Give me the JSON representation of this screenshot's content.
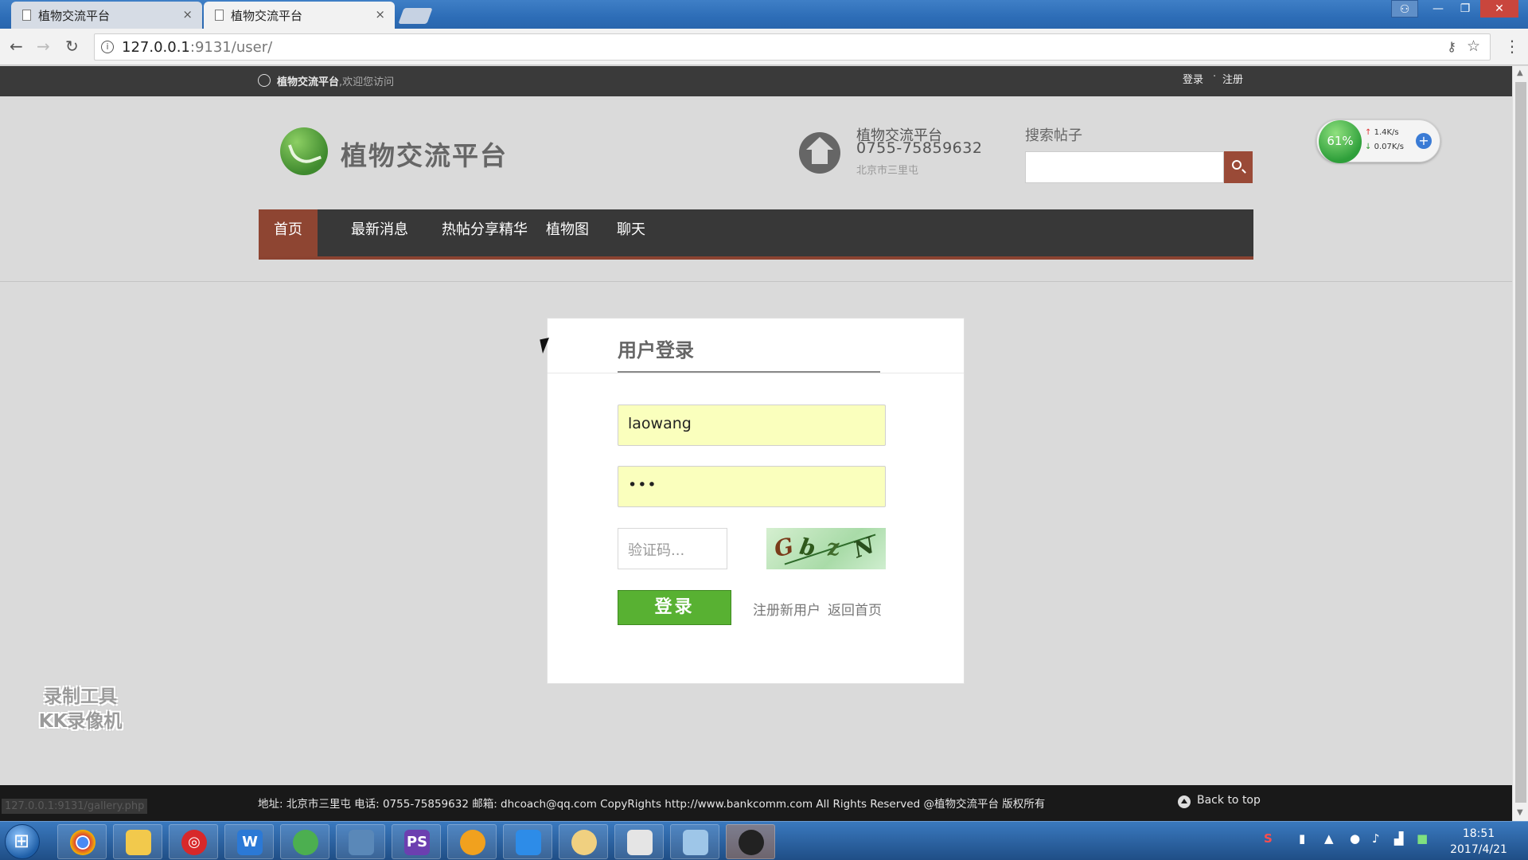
{
  "browser": {
    "tabs": [
      {
        "title": "植物交流平台",
        "close": "×"
      },
      {
        "title": "植物交流平台",
        "close": "×"
      }
    ],
    "url_host": "127.0.0.1",
    "url_path": ":9131/user/",
    "window_controls": {
      "min": "—",
      "max": "❐",
      "close": "✕",
      "user": "⚇"
    }
  },
  "topstrip": {
    "site_name": "植物交流平台",
    "welcome": ",欢迎您访问",
    "login": "登录",
    "dot": "·",
    "register": "注册"
  },
  "header": {
    "logo_text": "植物交流平台",
    "contact_name": "植物交流平台",
    "contact_phone": "0755-75859632",
    "contact_address": "北京市三里屯",
    "search_label": "搜索帖子",
    "search_value": ""
  },
  "netwidget": {
    "percent": "61%",
    "up": "1.4K/s",
    "down": "0.07K/s"
  },
  "nav": [
    {
      "label": "首页",
      "active": true
    },
    {
      "label": "最新消息",
      "active": false
    },
    {
      "label": "热帖分享精华",
      "active": false
    },
    {
      "label": "植物图",
      "active": false
    },
    {
      "label": "聊天",
      "active": false
    }
  ],
  "login": {
    "title": "用户登录",
    "username": "laowang",
    "password": "•••",
    "captcha_placeholder": "验证码...",
    "captcha_chars": [
      "G",
      "b",
      "z",
      "N"
    ],
    "submit": "登录",
    "register_link": "注册新用户",
    "home_link": "返回首页"
  },
  "watermark": {
    "line1": "录制工具",
    "line2": "KK录像机"
  },
  "footer": {
    "text": "地址: 北京市三里屯  电话: 0755-75859632    邮箱: dhcoach@qq.com CopyRights http://www.bankcomm.com All Rights Reserved @植物交流平台 版权所有",
    "back_to_top": "Back to top"
  },
  "status_url": "127.0.0.1:9131/gallery.php",
  "taskbar": {
    "apps": [
      "chrome",
      "explorer",
      "netease-music",
      "wps-writer",
      "green-app",
      "photo-viewer",
      "phpstorm",
      "qq-browser",
      "feishu-bird",
      "palette",
      "reader",
      "notepad",
      "kk-recorder"
    ],
    "clock_time": "18:51",
    "clock_date": "2017/4/21"
  },
  "colors": {
    "accent_brown": "#8e4532",
    "nav_bg": "#383838",
    "login_green": "#58b132",
    "autofill_yellow": "#faffbd"
  }
}
